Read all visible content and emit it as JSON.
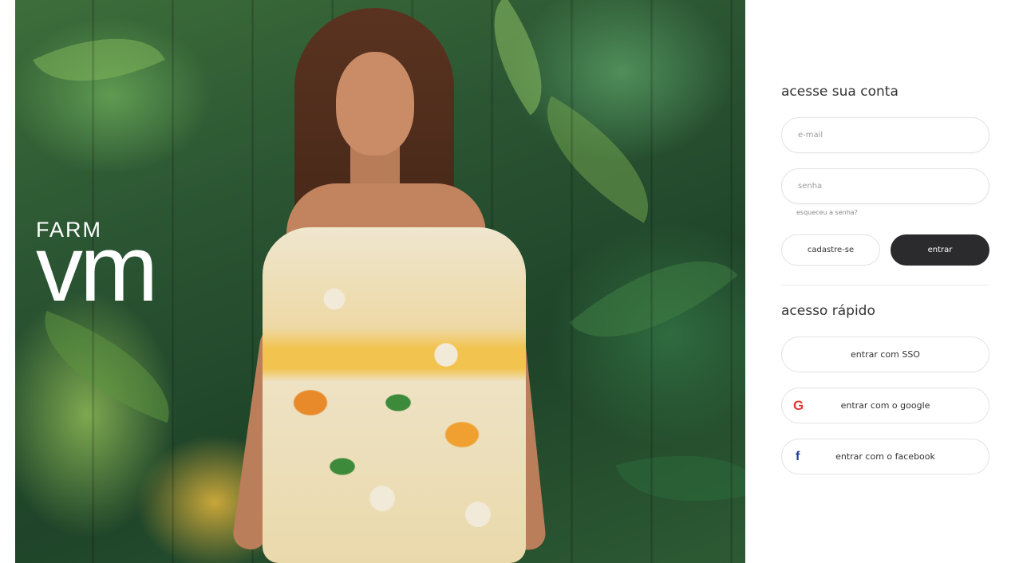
{
  "brand": {
    "farm": "FARM",
    "vm": "vm"
  },
  "login": {
    "title": "acesse sua conta",
    "email_placeholder": "e-mail",
    "password_placeholder": "senha",
    "forgot_password": "esqueceu a senha?",
    "register_button": "cadastre-se",
    "submit_button": "entrar"
  },
  "quick_access": {
    "title": "acesso rápido",
    "sso_button": "entrar com SSO",
    "google_button": "entrar com o google",
    "facebook_button": "entrar com o facebook",
    "google_icon": "G",
    "facebook_icon": "f"
  },
  "colors": {
    "primary_button": "#2b2b2d",
    "google": "#e53935",
    "facebook": "#1f3a93"
  }
}
